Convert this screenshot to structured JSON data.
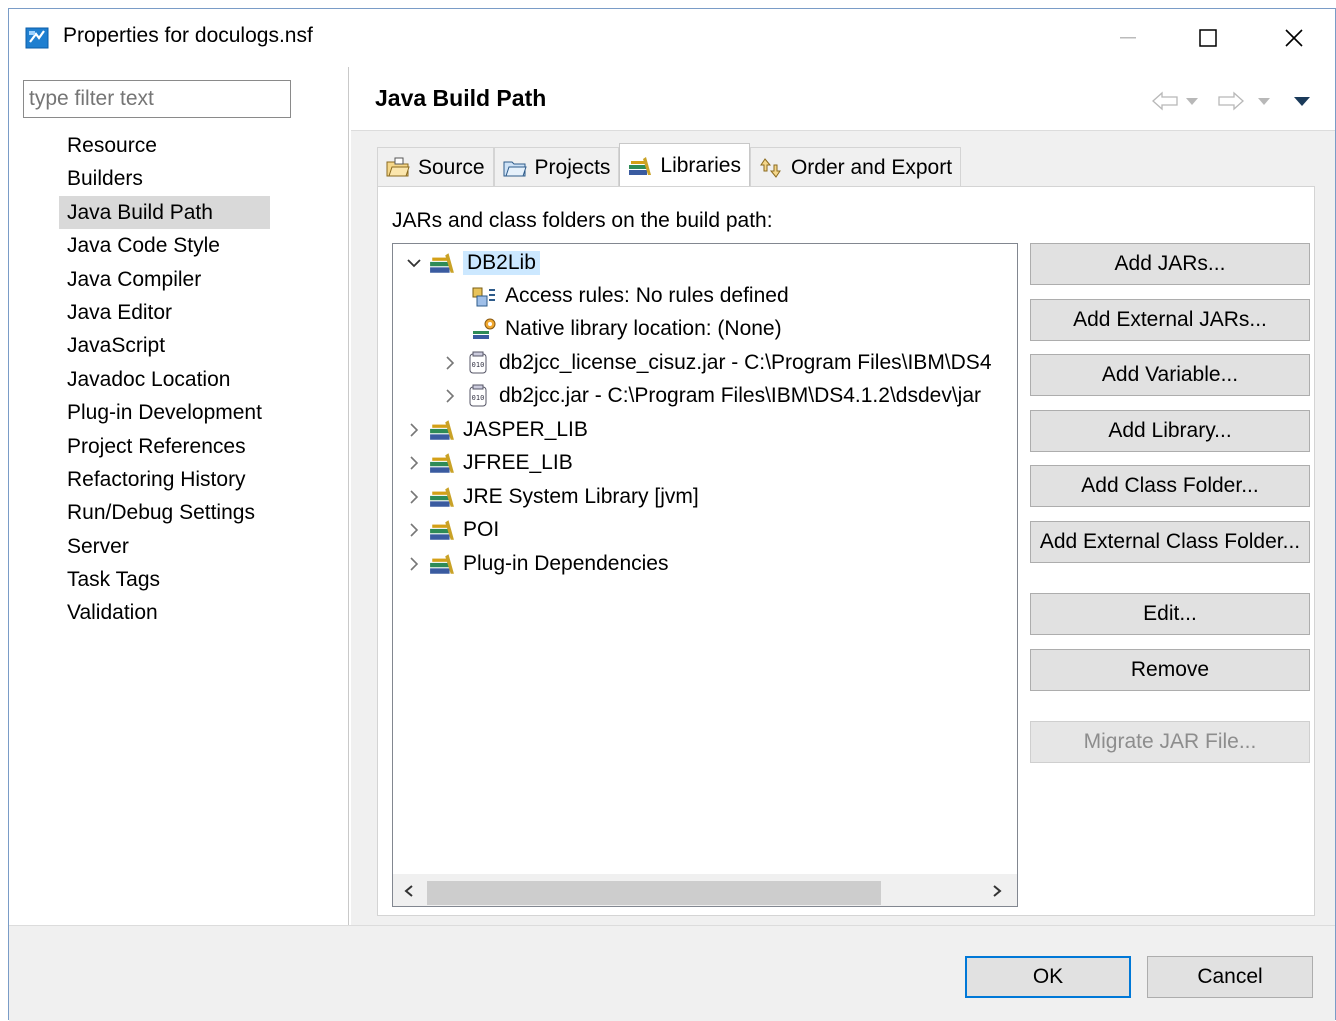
{
  "window": {
    "title": "Properties for doculogs.nsf",
    "controls": {
      "minimize": "—",
      "maximize": "☐",
      "close": "✕"
    }
  },
  "filter": {
    "placeholder": "type filter text",
    "value": ""
  },
  "nav": {
    "items": [
      "Resource",
      "Builders",
      "Java Build Path",
      "Java Code Style",
      "Java Compiler",
      "Java Editor",
      "JavaScript",
      "Javadoc Location",
      "Plug-in Development",
      "Project References",
      "Refactoring History",
      "Run/Debug Settings",
      "Server",
      "Task Tags",
      "Validation"
    ],
    "selected": "Java Build Path"
  },
  "page": {
    "title": "Java Build Path"
  },
  "tabs": [
    {
      "label": "Source",
      "icon": "source-folder-icon"
    },
    {
      "label": "Projects",
      "icon": "projects-folder-icon"
    },
    {
      "label": "Libraries",
      "icon": "library-icon",
      "active": true
    },
    {
      "label": "Order and Export",
      "icon": "order-export-icon"
    }
  ],
  "libraries": {
    "label": "JARs and class folders on the build path:",
    "tree": {
      "db2lib": "DB2Lib",
      "access_rules": "Access rules: No rules defined",
      "native_location": "Native library location: (None)",
      "jar1": "db2jcc_license_cisuz.jar - C:\\Program Files\\IBM\\DS4",
      "jar2": "db2jcc.jar - C:\\Program Files\\IBM\\DS4.1.2\\dsdev\\jar",
      "jasper": "JASPER_LIB",
      "jfree": "JFREE_LIB",
      "jre": "JRE System Library [jvm]",
      "poi": "POI",
      "plugin": "Plug-in Dependencies"
    },
    "buttons": {
      "add_jars": "Add JARs...",
      "add_external_jars": "Add External JARs...",
      "add_variable": "Add Variable...",
      "add_library": "Add Library...",
      "add_class_folder": "Add Class Folder...",
      "add_external_class_folder": "Add External Class Folder...",
      "edit": "Edit...",
      "remove": "Remove",
      "migrate": "Migrate JAR File..."
    }
  },
  "dialog": {
    "ok": "OK",
    "cancel": "Cancel"
  },
  "colors": {
    "selection": "#cce8ff",
    "nav_selected": "#d9d9d9",
    "default_button_border": "#0078d7"
  }
}
